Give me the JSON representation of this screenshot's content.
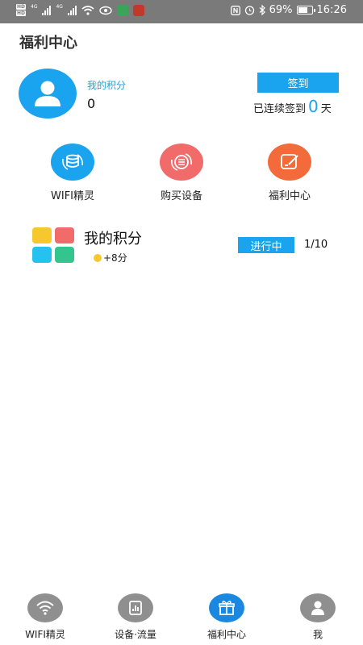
{
  "status_bar": {
    "network": "4G",
    "battery": "69%",
    "battery_level": 0.69,
    "time": "16:26"
  },
  "header": {
    "title": "福利中心"
  },
  "points_card": {
    "label": "我的积分",
    "value": "0",
    "signin_label": "签到",
    "streak_prefix": "已连续签到",
    "streak_days": "0",
    "streak_suffix": "天"
  },
  "features": [
    {
      "label": "WIFI精灵",
      "icon": "wifi-db-icon",
      "color": "#1aa3ef"
    },
    {
      "label": "购买设备",
      "icon": "list-icon",
      "color": "#f26b6b"
    },
    {
      "label": "福利中心",
      "icon": "edit-icon",
      "color": "#f36b3a"
    }
  ],
  "task": {
    "title": "我的积分",
    "reward": "+8分",
    "status": "进行中",
    "progress": "1/10",
    "tile_colors": [
      "#f7c82e",
      "#f26b6b",
      "#25c2f0",
      "#34c48e"
    ]
  },
  "bottom_nav": {
    "items": [
      {
        "label": "WIFI精灵",
        "icon": "wifi-icon"
      },
      {
        "label": "设备·流量",
        "icon": "chart-icon"
      },
      {
        "label": "福利中心",
        "icon": "gift-icon",
        "active": true
      },
      {
        "label": "我",
        "icon": "user-icon"
      }
    ]
  },
  "colors": {
    "accent": "#1aa3ef",
    "active_nav": "#1a87e0",
    "inactive_nav": "#8f8f8f"
  }
}
